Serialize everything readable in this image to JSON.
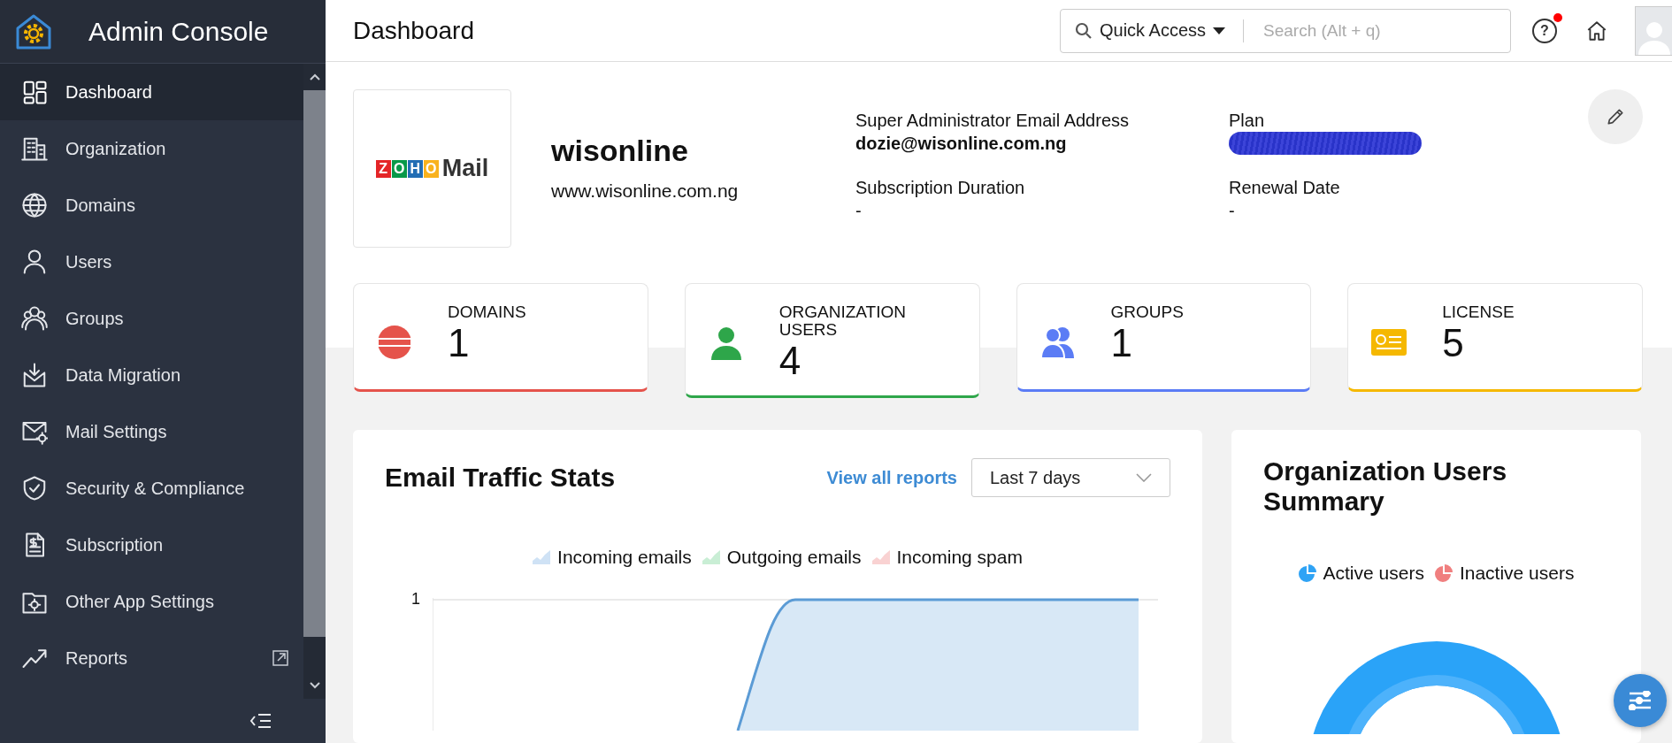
{
  "app": {
    "title": "Admin Console"
  },
  "sidebar": {
    "items": [
      {
        "label": "Dashboard",
        "selected": true
      },
      {
        "label": "Organization",
        "selected": false
      },
      {
        "label": "Domains",
        "selected": false
      },
      {
        "label": "Users",
        "selected": false
      },
      {
        "label": "Groups",
        "selected": false
      },
      {
        "label": "Data Migration",
        "selected": false
      },
      {
        "label": "Mail Settings",
        "selected": false
      },
      {
        "label": "Security & Compliance",
        "selected": false
      },
      {
        "label": "Subscription",
        "selected": false
      },
      {
        "label": "Other App Settings",
        "selected": false
      },
      {
        "label": "Reports",
        "selected": false,
        "external": true
      }
    ]
  },
  "header": {
    "title": "Dashboard",
    "quick_access": "Quick Access",
    "search": {
      "placeholder": "Search (Alt + q)"
    },
    "help": {
      "glyph": "?",
      "has_notification": true
    }
  },
  "organization": {
    "logo": {
      "letters": [
        {
          "char": "Z",
          "color": "#e42527"
        },
        {
          "char": "O",
          "color": "#089949"
        },
        {
          "char": "H",
          "color": "#226db4"
        },
        {
          "char": "O",
          "color": "#f9b21d"
        }
      ],
      "word": "Mail"
    },
    "name": "wisonline",
    "website": "www.wisonline.com.ng",
    "fields": [
      {
        "label": "Super Administrator Email Address",
        "value": "dozie@wisonline.com.ng",
        "bold": true
      },
      {
        "label": "Plan",
        "redacted": true
      },
      {
        "label": "Subscription Duration",
        "value": "-",
        "bold": false
      },
      {
        "label": "Renewal Date",
        "value": "-",
        "bold": false
      }
    ]
  },
  "stats": [
    {
      "label": "DOMAINS",
      "value": "1",
      "color": "#e5534b"
    },
    {
      "label": "ORGANIZATION USERS",
      "value": "4",
      "color": "#2ea64a"
    },
    {
      "label": "GROUPS",
      "value": "1",
      "color": "#5b7cf5"
    },
    {
      "label": "LICENSE",
      "value": "5",
      "color": "#f5b800"
    }
  ],
  "traffic": {
    "title": "Email Traffic Stats",
    "link": "View all reports",
    "range": "Last 7 days",
    "legend": [
      {
        "label": "Incoming emails",
        "color": "#cfe2f5"
      },
      {
        "label": "Outgoing emails",
        "color": "#c9eed5"
      },
      {
        "label": "Incoming spam",
        "color": "#f9d2d2"
      }
    ],
    "y_tick": "1"
  },
  "users_summary": {
    "title": "Organization Users Summary",
    "legend": [
      {
        "label": "Active users",
        "color": "#2fa3f5"
      },
      {
        "label": "Inactive users",
        "color": "#f07f7f"
      }
    ]
  }
}
